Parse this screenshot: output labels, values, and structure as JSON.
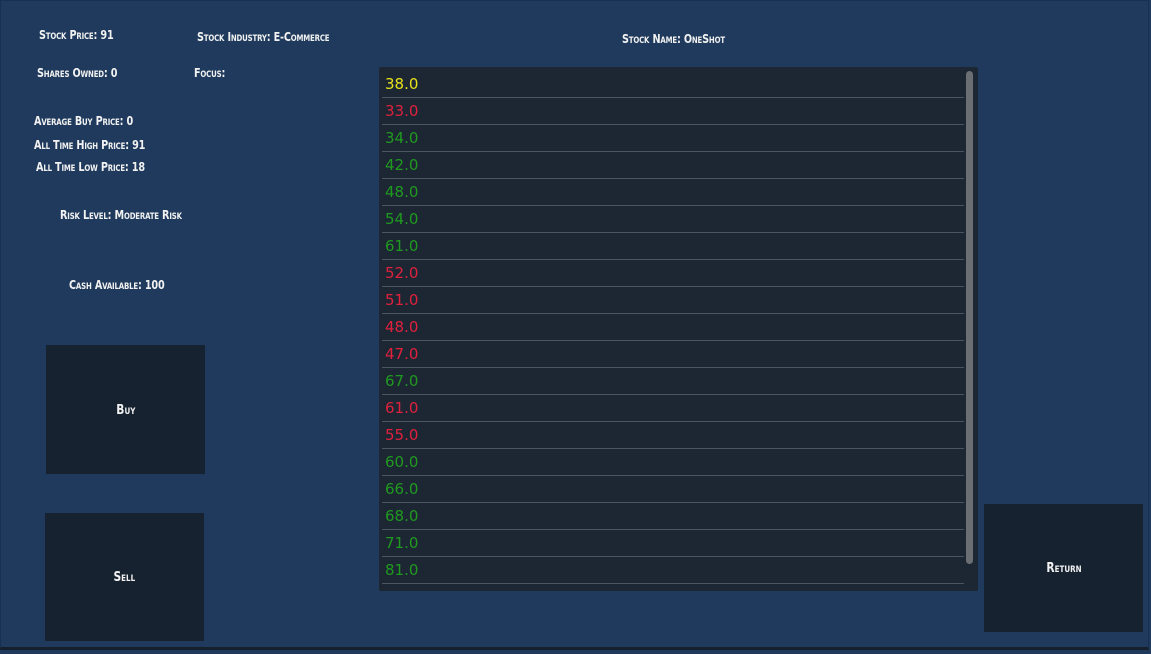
{
  "labels": {
    "stock_price": "Stock Price: 91",
    "stock_industry": "Stock Industry: E-Commerce",
    "stock_name": "Stock Name: OneShot",
    "shares_owned": "Shares Owned: 0",
    "focus": "Focus:",
    "average_buy_price": "Average Buy Price: 0",
    "all_time_high": "All Time High Price: 91",
    "all_time_low": "All Time Low Price: 18",
    "risk_level": "Risk Level: Moderate Risk",
    "cash_available": "Cash Available: 100"
  },
  "buttons": {
    "buy": "Buy",
    "sell": "Sell",
    "return": "Return"
  },
  "colors": {
    "background": "#1f3a5c",
    "panel": "#1d2733",
    "button": "#172230",
    "neutral": "#e8e21a",
    "up": "#1f9a1f",
    "down": "#e0203c"
  },
  "price_history": [
    {
      "value": "38.0",
      "trend": "neutral"
    },
    {
      "value": "33.0",
      "trend": "down"
    },
    {
      "value": "34.0",
      "trend": "up"
    },
    {
      "value": "42.0",
      "trend": "up"
    },
    {
      "value": "48.0",
      "trend": "up"
    },
    {
      "value": "54.0",
      "trend": "up"
    },
    {
      "value": "61.0",
      "trend": "up"
    },
    {
      "value": "52.0",
      "trend": "down"
    },
    {
      "value": "51.0",
      "trend": "down"
    },
    {
      "value": "48.0",
      "trend": "down"
    },
    {
      "value": "47.0",
      "trend": "down"
    },
    {
      "value": "67.0",
      "trend": "up"
    },
    {
      "value": "61.0",
      "trend": "down"
    },
    {
      "value": "55.0",
      "trend": "down"
    },
    {
      "value": "60.0",
      "trend": "up"
    },
    {
      "value": "66.0",
      "trend": "up"
    },
    {
      "value": "68.0",
      "trend": "up"
    },
    {
      "value": "71.0",
      "trend": "up"
    },
    {
      "value": "81.0",
      "trend": "up"
    }
  ]
}
